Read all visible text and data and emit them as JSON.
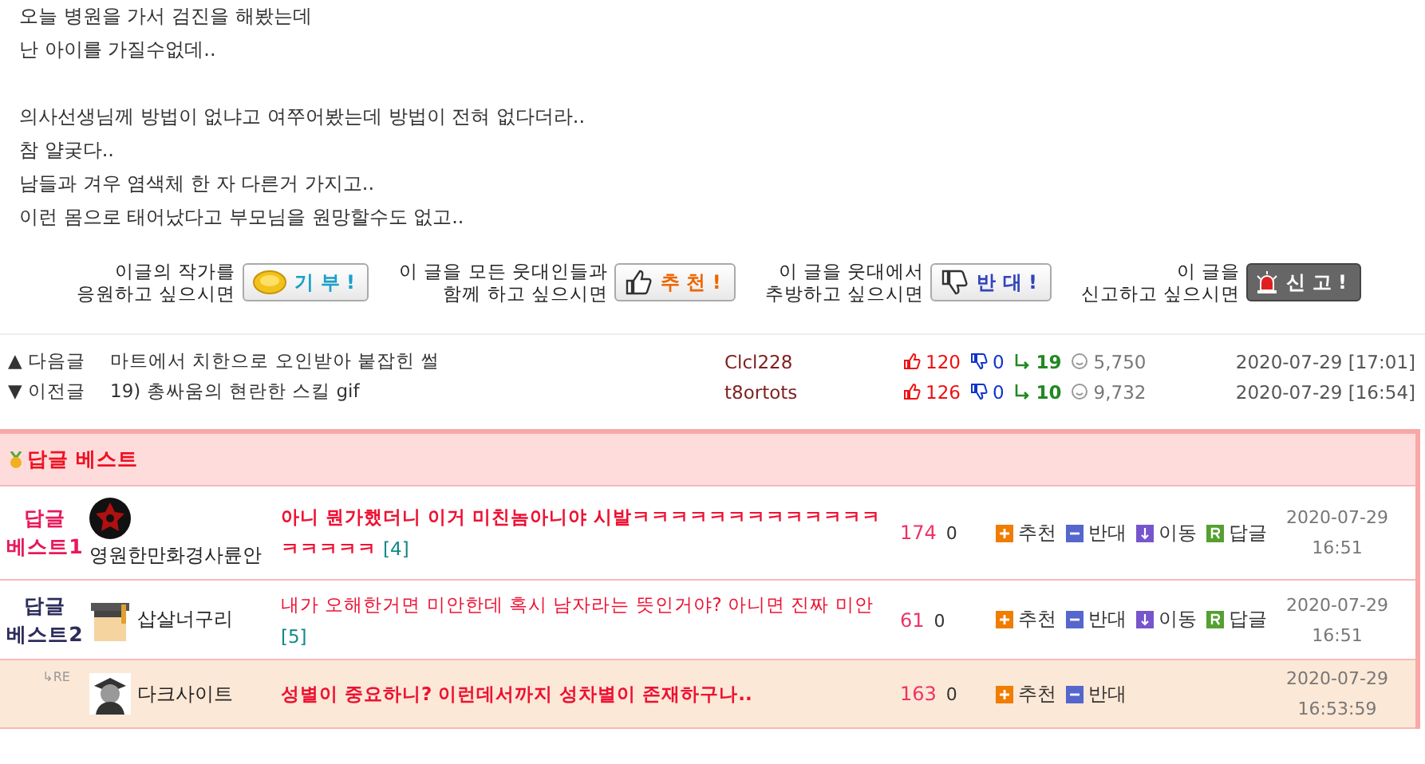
{
  "post": {
    "paragraphs": [
      [
        "오늘 병원을 가서 검진을 해봤는데",
        "난 아이를 가질수없데.."
      ],
      [
        "의사선생님께 방법이 없냐고 여쭈어봤는데 방법이 전혀 없다더라..",
        "참 얄궂다..",
        "남들과 겨우 염색체 한 자 다른거 가지고..",
        "이런 몸으로 태어났다고 부모님을 원망할수도 없고.."
      ]
    ]
  },
  "actions": [
    {
      "kind": "donate",
      "prompt": [
        "이글의 작가를",
        "응원하고 싶으시면"
      ],
      "label": "기 부 !"
    },
    {
      "kind": "recommend",
      "prompt": [
        "이 글을 모든 웃대인들과",
        "함께 하고 싶으시면"
      ],
      "label": "추 천 !"
    },
    {
      "kind": "oppose",
      "prompt": [
        "이 글을 웃대에서",
        "추방하고 싶으시면"
      ],
      "label": "반 대 !"
    },
    {
      "kind": "report",
      "prompt": [
        "이 글을",
        "신고하고 싶으시면"
      ],
      "label": "신 고 !"
    }
  ],
  "nav": [
    {
      "arrow": "▲",
      "label": "다음글",
      "title": "마트에서 치한으로 오인받아 붙잡힌 썰",
      "author": "Clcl228",
      "up": "120",
      "down": "0",
      "replies": "19",
      "views": "5,750",
      "date": "2020-07-29 [17:01]"
    },
    {
      "arrow": "▼",
      "label": "이전글",
      "title": "19) 총싸움의 현란한 스킬 gif",
      "author": "t8ortots",
      "up": "126",
      "down": "0",
      "replies": "10",
      "views": "9,732",
      "date": "2020-07-29 [16:54]"
    }
  ],
  "best": {
    "title": "답글 베스트",
    "comments": [
      {
        "kind": "best",
        "rank": [
          "답글",
          "베스트1"
        ],
        "color": "#e8185a",
        "avatar": {
          "kind": "star"
        },
        "name": "영원한만화경사륜안",
        "name_below": true,
        "text": "아니 뭔가했더니 이거 미친놈아니야 시발ㅋㅋㅋㅋㅋㅋㅋㅋㅋㅋㅋㅋㅋㅋㅋㅋㅋㅋ",
        "replies": "[4]",
        "bold": true,
        "up": "174",
        "down": "0",
        "buttons": [
          {
            "kind": "up",
            "label": "추천"
          },
          {
            "kind": "down",
            "label": "반대"
          },
          {
            "kind": "move",
            "label": "이동"
          },
          {
            "kind": "reply",
            "label": "답글"
          }
        ],
        "date": "2020-07-29",
        "time": "16:51"
      },
      {
        "kind": "best",
        "rank": [
          "답글",
          "베스트2"
        ],
        "color": "#2c2c5c",
        "avatar": {
          "kind": "cap"
        },
        "name": "삽살너구리",
        "name_below": false,
        "text": "내가 오해한거면 미안한데  혹시 남자라는 뜻인거야? 아니면 진짜 미안",
        "replies": "[5]",
        "bold": false,
        "up": "61",
        "down": "0",
        "buttons": [
          {
            "kind": "up",
            "label": "추천"
          },
          {
            "kind": "down",
            "label": "반대"
          },
          {
            "kind": "move",
            "label": "이동"
          },
          {
            "kind": "reply",
            "label": "답글"
          }
        ],
        "date": "2020-07-29",
        "time": "16:51"
      },
      {
        "kind": "reply",
        "mark": "↳RE",
        "avatar": {
          "kind": "figure"
        },
        "name": "다크사이트",
        "name_below": false,
        "text": "성별이 중요하니? 이런데서까지 성차별이 존재하구나..",
        "bold": true,
        "up": "163",
        "down": "0",
        "buttons": [
          {
            "kind": "up",
            "label": "추천"
          },
          {
            "kind": "down",
            "label": "반대"
          }
        ],
        "date": "2020-07-29",
        "time": "16:53:59"
      }
    ]
  }
}
